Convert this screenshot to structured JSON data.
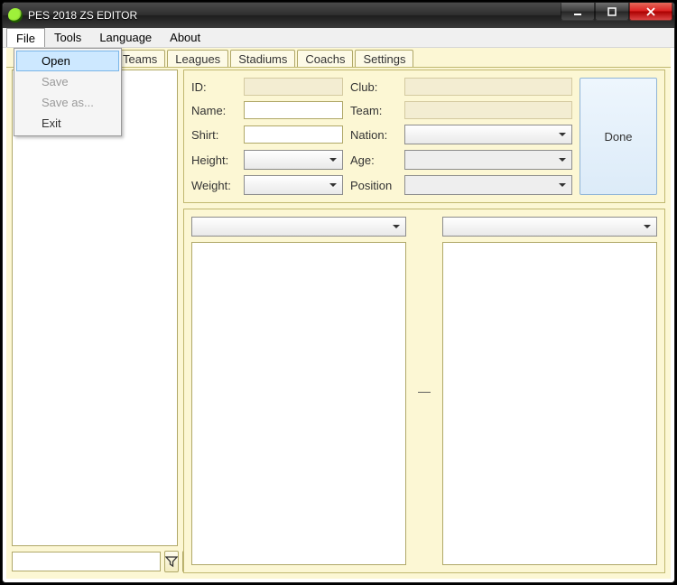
{
  "window": {
    "title": "PES 2018 ZS EDITOR"
  },
  "menu": {
    "items": [
      "File",
      "Tools",
      "Language",
      "About"
    ],
    "file_dropdown": {
      "open": "Open",
      "save": "Save",
      "save_as": "Save as...",
      "exit": "Exit"
    }
  },
  "tabs": [
    "Teams",
    "Leagues",
    "Stadiums",
    "Coachs",
    "Settings"
  ],
  "form": {
    "labels": {
      "id": "ID:",
      "name": "Name:",
      "shirt": "Shirt:",
      "height": "Height:",
      "weight": "Weight:",
      "club": "Club:",
      "team": "Team:",
      "nation": "Nation:",
      "age": "Age:",
      "position": "Position"
    },
    "values": {
      "id": "",
      "name": "",
      "shirt": "",
      "height": "",
      "weight": "",
      "club": "",
      "team": "",
      "nation": "",
      "age": "",
      "position": ""
    },
    "done": "Done"
  },
  "mid_divider": "—",
  "filter_value": ""
}
